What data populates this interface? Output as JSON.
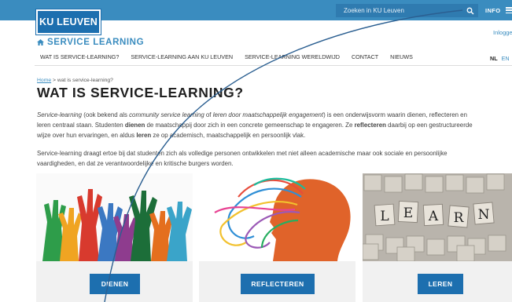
{
  "header": {
    "logo": "KU LEUVEN",
    "search_placeholder": "Zoeken in KU Leuven",
    "info_label": "INFO",
    "login_label": "Inloggen",
    "section_title": "SERVICE LEARNING"
  },
  "nav": [
    "WAT IS SERVICE-LEARNING?",
    "SERVICE-LEARNING AAN KU LEUVEN",
    "SERVICE-LEARNING WERELDWIJD",
    "CONTACT",
    "NIEUWS"
  ],
  "lang": {
    "nl": "NL",
    "en": "EN"
  },
  "breadcrumb": {
    "home": "Home",
    "sep": ">",
    "current": "wat is service-learning?"
  },
  "page_title": "WAT IS SERVICE-LEARNING?",
  "p1": {
    "l1a": "Service-learning",
    "l1b": " (ook bekend als ",
    "l1c": "community service learning",
    "l1d": " of ",
    "l1e": "leren door maatschappelijk engagement",
    "l1f": ") is een onderwijsvorm waarin dienen, reflecteren en",
    "l2a": "leren centraal staan. Studenten ",
    "l2b": "dienen",
    "l2c": " de maatschappij door zich in een concrete gemeenschap te engageren. Ze ",
    "l2d": "reflecteren",
    "l2e": " daarbij op een gestructureerde",
    "l3a": "wijze over hun ervaringen, en aldus ",
    "l3b": "leren",
    "l3c": " ze op academisch, maatschappelijk en persoonlijk vlak."
  },
  "p2": {
    "l1": "Service-learning draagt ertoe bij dat studenten zich als volledige personen ontwikkelen met niet alleen academische maar ook sociale en persoonlijke",
    "l2": "vaardigheden, en dat ze verantwoordelijke en kritische burgers worden."
  },
  "cards": [
    {
      "label": "DIENEN"
    },
    {
      "label": "REFLECTEREN"
    },
    {
      "label": "LEREN"
    }
  ],
  "tiles": [
    "L",
    "E",
    "A",
    "R",
    "N"
  ],
  "colors": {
    "topbar": "#3a8cbf",
    "brand_blue": "#1d6faf",
    "accent": "#3a8cbf",
    "annotation_line": "#2b5f91"
  }
}
